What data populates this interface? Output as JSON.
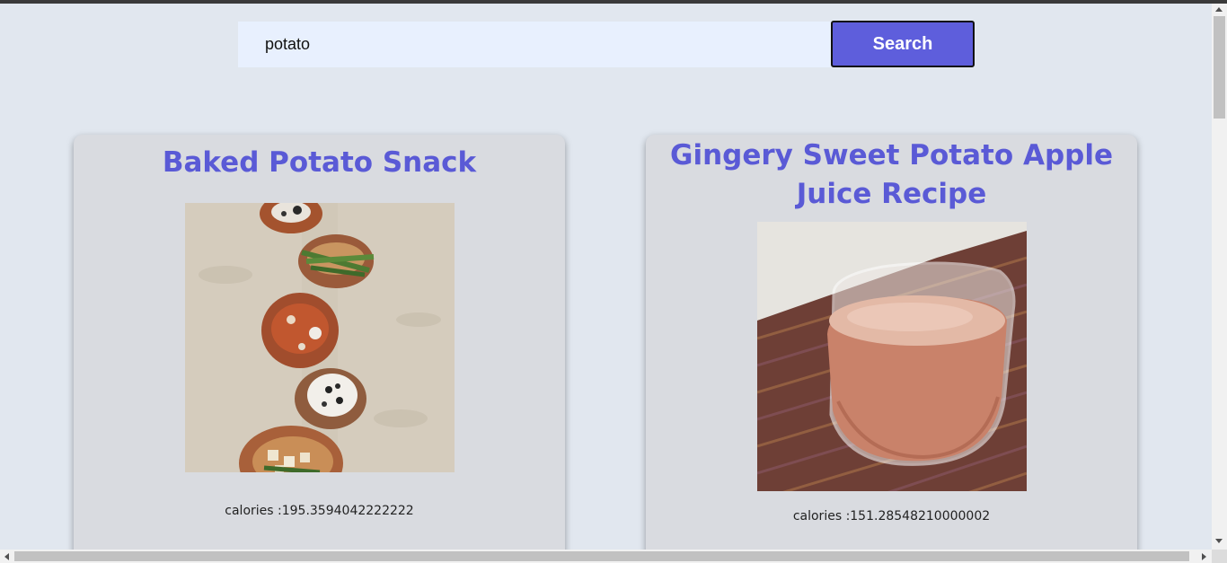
{
  "search": {
    "value": "potato",
    "button_label": "Search"
  },
  "results": [
    {
      "title": "Baked Potato Snack",
      "calories_text": "calories :195.3594042222222",
      "image_icon": "baked-potatoes-image"
    },
    {
      "title": "Gingery Sweet Potato Apple Juice Recipe",
      "calories_text": "calories :151.28548210000002",
      "image_icon": "juice-glass-image"
    }
  ],
  "colors": {
    "accent": "#5e5edc",
    "title": "#5a5ad6",
    "background": "#e1e7ef",
    "card": "#d9dbe0",
    "input": "#e8f0fe"
  }
}
